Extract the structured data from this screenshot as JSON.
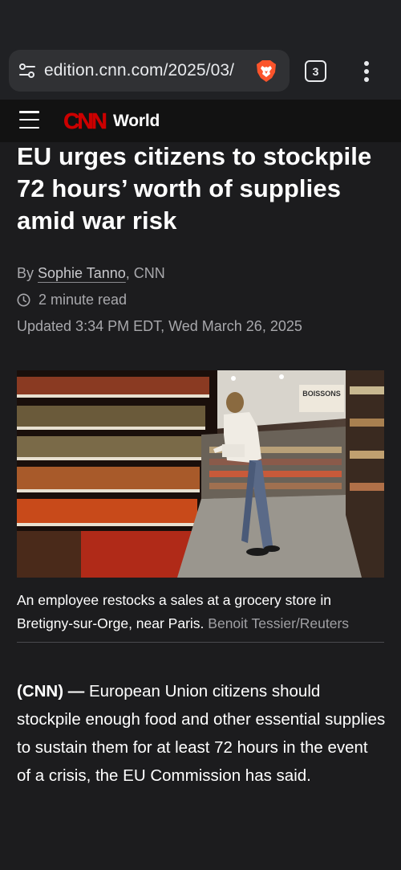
{
  "browser": {
    "url": "edition.cnn.com/2025/03/",
    "tab_count": "3"
  },
  "header": {
    "logo_text": "CNN",
    "section": "World"
  },
  "article": {
    "headline": "EU urges citizens to stockpile 72 hours’ worth of supplies amid war risk",
    "byline_prefix": "By ",
    "author": "Sophie Tanno",
    "byline_suffix": ", CNN",
    "read_time": "2 minute read",
    "updated": "Updated 3:34 PM EDT, Wed March 26, 2025",
    "photo_sign": "BOISSONS",
    "caption": "An employee restocks a sales at a grocery store in Bretigny-sur-Orge, near Paris.",
    "caption_credit": "Benoit Tessier/Reuters",
    "dateline": "(CNN) —",
    "lede": " European Union citizens should stockpile enough food and other essential supplies to sustain them for at least 72 hours in the event of a crisis, the EU Commission has said."
  },
  "colors": {
    "cnn_red": "#cc0000",
    "background": "#1c1c1e",
    "header_bg": "#121212",
    "brave_orange": "#fb542b"
  }
}
